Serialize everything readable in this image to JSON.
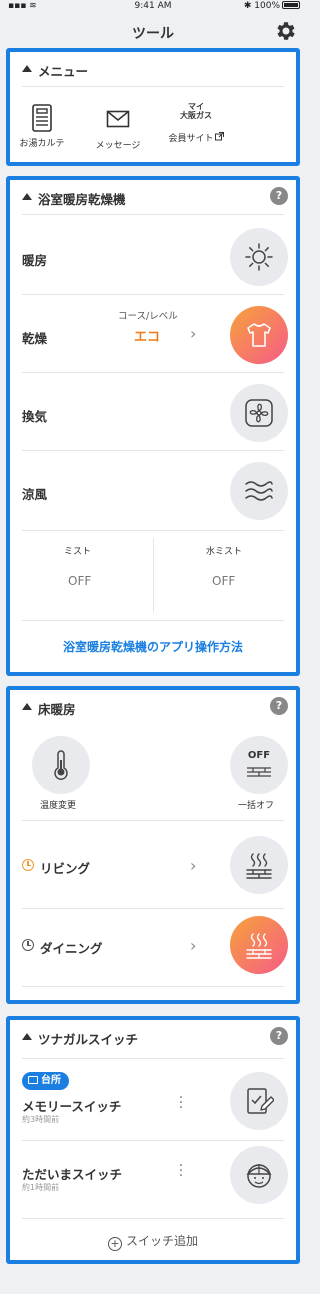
{
  "status_bar": {
    "time": "9:41 AM",
    "battery": "100%",
    "signal": "▪▪▪ ≋",
    "bluetooth": "✱"
  },
  "header": {
    "title": "ツール",
    "settings_icon": "gear-icon"
  },
  "menu": {
    "title": "メニュー",
    "items": [
      {
        "label": "お湯カルテ",
        "icon": "document-icon"
      },
      {
        "label": "メッセージ",
        "icon": "envelope-icon"
      },
      {
        "label": "会員サイト",
        "logo_line1": "マイ",
        "logo_line2": "大阪ガス",
        "icon": "external-link-icon"
      }
    ]
  },
  "bathroom": {
    "title": "浴室暖房乾燥機",
    "help": "?",
    "heating": {
      "label": "暖房",
      "icon": "sun-icon"
    },
    "drying": {
      "label": "乾燥",
      "course_label": "コース/レベル",
      "course_value": "エコ",
      "icon": "shirt-icon",
      "active": true
    },
    "ventilation": {
      "label": "換気",
      "icon": "fan-icon"
    },
    "cool": {
      "label": "涼風",
      "icon": "wind-icon"
    },
    "mist": {
      "label": "ミスト",
      "value": "OFF"
    },
    "water_mist": {
      "label": "水ミスト",
      "value": "OFF"
    },
    "app_link": "浴室暖房乾燥機のアプリ操作方法"
  },
  "floor": {
    "title": "床暖房",
    "help": "?",
    "temp_change": {
      "label": "温度変更",
      "icon": "thermometer-icon"
    },
    "all_off": {
      "label": "一括オフ",
      "icon_text": "OFF",
      "icon": "floor-off-icon"
    },
    "rooms": [
      {
        "name": "リビング",
        "active": false,
        "timer_color": "#f29a2e"
      },
      {
        "name": "ダイニング",
        "active": true,
        "timer_color": "#555555"
      }
    ]
  },
  "switches": {
    "title": "ツナガルスイッチ",
    "help": "?",
    "items": [
      {
        "badge": "台所",
        "name": "メモリースイッチ",
        "time": "約3時間前",
        "icon": "clipboard-edit-icon"
      },
      {
        "name": "ただいまスイッチ",
        "time": "約1時間前",
        "icon": "child-face-icon"
      }
    ],
    "add_label": "スイッチ追加"
  },
  "colors": {
    "accent": "#1a7fe0",
    "orange": "#f29a2e",
    "gradient_start": "#f7a23b",
    "gradient_end": "#f55c87"
  }
}
